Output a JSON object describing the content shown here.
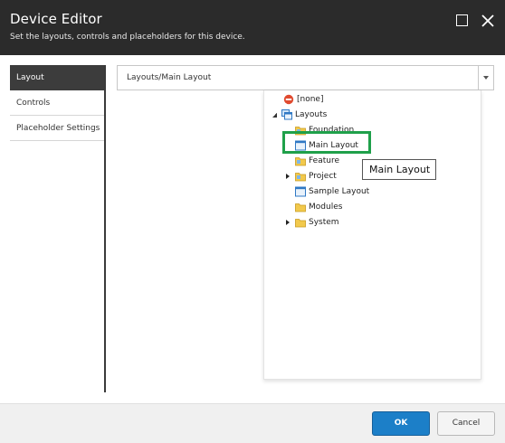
{
  "window": {
    "title": "Device Editor",
    "subtitle": "Set the layouts, controls and placeholders for this device.",
    "maximize_icon": "maximize-icon",
    "close_icon": "close-icon"
  },
  "tabs": [
    {
      "label": "Layout",
      "active": true
    },
    {
      "label": "Controls",
      "active": false
    },
    {
      "label": "Placeholder Settings",
      "active": false
    }
  ],
  "layout_select": {
    "value": "Layouts/Main Layout"
  },
  "tree": [
    {
      "label": "[none]",
      "icon": "none-icon",
      "expander": "none"
    },
    {
      "label": "Layouts",
      "icon": "layouts-icon",
      "expander": "expanded"
    },
    {
      "label": "Foundation",
      "icon": "folder-icon",
      "expander": "none"
    },
    {
      "label": "Main Layout",
      "icon": "layout-icon",
      "expander": "none"
    },
    {
      "label": "Feature",
      "icon": "folder-icon",
      "expander": "none"
    },
    {
      "label": "Project",
      "icon": "folder-icon",
      "expander": "collapsed"
    },
    {
      "label": "Sample Layout",
      "icon": "layout-icon",
      "expander": "none"
    },
    {
      "label": "Modules",
      "icon": "folder-icon",
      "expander": "none"
    },
    {
      "label": "System",
      "icon": "folder-icon",
      "expander": "collapsed"
    }
  ],
  "tooltip": {
    "text": "Main Layout"
  },
  "footer": {
    "ok_label": "OK",
    "cancel_label": "Cancel"
  },
  "colors": {
    "titlebar": "#2b2b2b",
    "active_tab": "#3c3c3c",
    "ok_button": "#1c7fc8",
    "highlight": "#1fa04a"
  }
}
